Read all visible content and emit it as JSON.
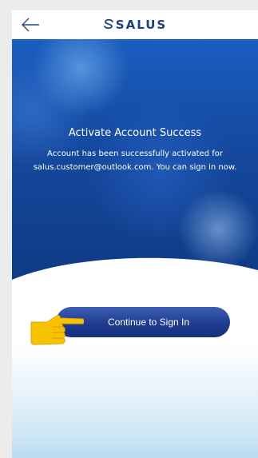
{
  "header": {
    "back_icon": "back-arrow-icon",
    "brand_label": "SALUS"
  },
  "hero": {
    "title": "Activate Account Success",
    "message": "Account has been successfully activated for salus.customer@outlook.com. You can sign in now."
  },
  "cta": {
    "label": "Continue to Sign In",
    "hand_icon": "pointing-hand-icon"
  },
  "colors": {
    "brand": "#1d3f84",
    "hero": "#1a5dc0",
    "button": "#1f3b8f",
    "hand": "#f7c300"
  }
}
